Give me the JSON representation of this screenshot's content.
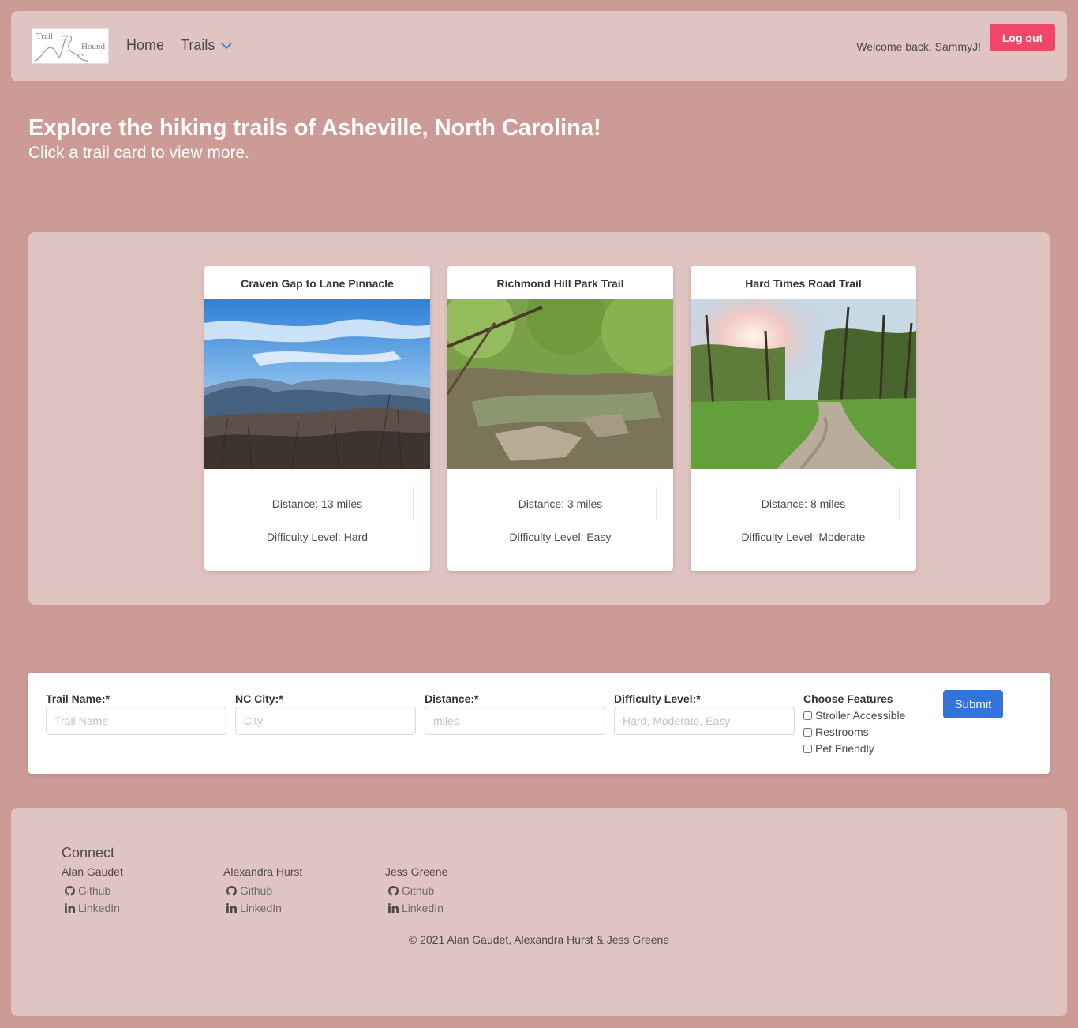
{
  "nav": {
    "logo_line1": "Trail",
    "logo_line2": "Hound",
    "home": "Home",
    "trails": "Trails",
    "welcome": "Welcome back, SammyJ!",
    "logout": "Log out"
  },
  "hero": {
    "title": "Explore the hiking trails of Asheville, North Carolina!",
    "subtitle": "Click a trail card to view more."
  },
  "cards": [
    {
      "title": "Craven Gap to Lane Pinnacle",
      "distance": "Distance: 13 miles",
      "difficulty": "Difficulty Level: Hard"
    },
    {
      "title": "Richmond Hill Park Trail",
      "distance": "Distance: 3 miles",
      "difficulty": "Difficulty Level: Easy"
    },
    {
      "title": "Hard Times Road Trail",
      "distance": "Distance: 8 miles",
      "difficulty": "Difficulty Level: Moderate"
    }
  ],
  "form": {
    "name_label": "Trail Name:*",
    "name_placeholder": "Trail Name",
    "city_label": "NC City:*",
    "city_placeholder": "City",
    "distance_label": "Distance:*",
    "distance_placeholder": "miles",
    "difficulty_label": "Difficulty Level:*",
    "difficulty_placeholder": "Hard, Moderate, Easy",
    "features_label": "Choose Features",
    "features": [
      "Stroller Accessible",
      "Restrooms",
      "Pet Friendly"
    ],
    "submit": "Submit"
  },
  "footer": {
    "connect": "Connect",
    "members": [
      {
        "name": "Alan Gaudet",
        "github": "Github",
        "linkedin": "LinkedIn"
      },
      {
        "name": "Alexandra Hurst",
        "github": "Github",
        "linkedin": "LinkedIn"
      },
      {
        "name": "Jess Greene",
        "github": "Github",
        "linkedin": "LinkedIn"
      }
    ],
    "copyright": "© 2021 Alan Gaudet, Alexandra Hurst & Jess Greene"
  },
  "colors": {
    "background": "#cc9b95",
    "panel": "#e0c4c2",
    "logout": "#f14668",
    "submit": "#3273dc"
  }
}
